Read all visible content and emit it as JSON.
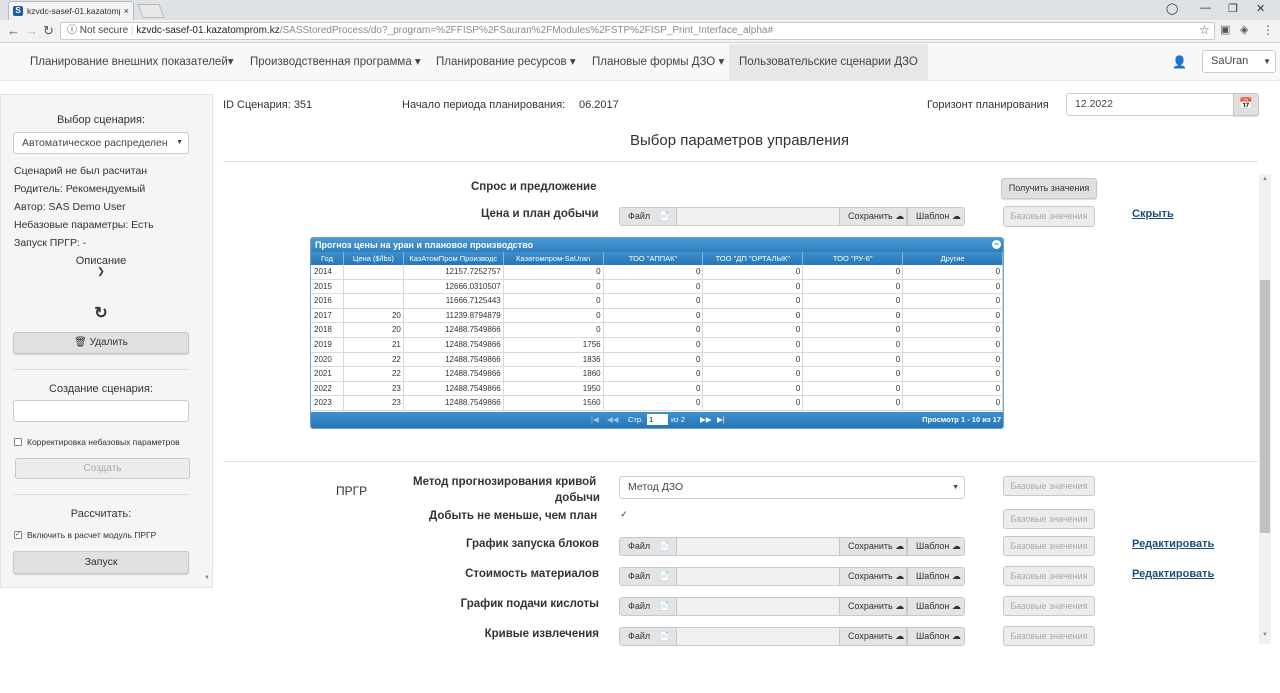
{
  "browser": {
    "tab_title": "kzvdc-sasef-01.kazatomp",
    "tab_close": "×",
    "security_label": "Not secure",
    "url_host": "kzvdc-sasef-01.kazatomprom.kz",
    "url_path": "/SASStoredProcess/do?_program=%2FFISP%2FSauran%2FModules%2FSTP%2FISP_Print_Interface_alpha#"
  },
  "nav": {
    "items": [
      {
        "label": "Планирование внешних показателей▾"
      },
      {
        "label": "Производственная программа ▾"
      },
      {
        "label": "Планирование ресурсов ▾"
      },
      {
        "label": "Плановые формы ДЗО ▾"
      },
      {
        "label": "Пользовательские сценарии ДЗО"
      }
    ],
    "user": "SaUran"
  },
  "left": {
    "scenario_select_label": "Выбор сценария:",
    "scenario_select_value": "Автоматическое распределен",
    "status": "Сценарий не был расчитан",
    "parent": "Родитель: Рекомендуемый",
    "author": "Автор: SAS Demo User",
    "nonbase": "Небазовые параметры: Есть",
    "prgr_run": "Запуск ПРГР: -",
    "description": "Описание",
    "delete_button": "Удалить",
    "create_label": "Создание сценария:",
    "create_input": "",
    "adjust_checkbox_label": "Корректировка небазовых параметров",
    "create_button": "Создать",
    "calc_label": "Рассчитать:",
    "include_checkbox_label": "Включить в расчет модуль ПРГР",
    "run_button": "Запуск"
  },
  "main": {
    "scenario_id": "ID Сценария: 351",
    "period_start_label": "Начало периода планирования:",
    "period_start_value": "06.2017",
    "horizon_label": "Горизонт планирования",
    "horizon_value": "12.2022",
    "title": "Выбор параметров управления",
    "demand_label": "Спрос и предложение",
    "get_values_button": "Получить значения",
    "price_label": "Цена и план добычи",
    "file_button": "Файл",
    "save_button": "Сохранить",
    "template_button": "Шаблон",
    "base_values_button": "Базовые значения",
    "hide_link": "Скрыть",
    "prgr_label": "ПРГР",
    "method_label_1": "Метод прогнозирования кривой",
    "method_label_2": "добычи",
    "method_value": "Метод ДЗО",
    "mine_not_less_label": "Добыть не меньше, чем план",
    "blocks_label": "График запуска блоков",
    "materials_label": "Стоимость материалов",
    "acid_label": "График подачи кислоты",
    "curves_label": "Кривые извлечения",
    "edit_link": "Редактировать"
  },
  "grid": {
    "caption": "Прогноз цены на уран и плановое производство",
    "columns": [
      "Год",
      "Цена ($/lbs)",
      "КазАтомПром Производс",
      "Казатомпром-SaUran",
      "ТОО \"АППАК\"",
      "ТОО \"ДП \"ОРТАЛЫК\"",
      "ТОО \"РУ-6\"",
      "Другие"
    ],
    "rows": [
      [
        "2014",
        "",
        "12157.7252757",
        "0",
        "0",
        "0",
        "0",
        "0"
      ],
      [
        "2015",
        "",
        "12666.0310507",
        "0",
        "0",
        "0",
        "0",
        "0"
      ],
      [
        "2016",
        "",
        "11666.7125443",
        "0",
        "0",
        "0",
        "0",
        "0"
      ],
      [
        "2017",
        "20",
        "11239.8794879",
        "0",
        "0",
        "0",
        "0",
        "0"
      ],
      [
        "2018",
        "20",
        "12488.7549866",
        "0",
        "0",
        "0",
        "0",
        "0"
      ],
      [
        "2019",
        "21",
        "12488.7549866",
        "1756",
        "0",
        "0",
        "0",
        "0"
      ],
      [
        "2020",
        "22",
        "12488.7549866",
        "1836",
        "0",
        "0",
        "0",
        "0"
      ],
      [
        "2021",
        "22",
        "12488.7549866",
        "1860",
        "0",
        "0",
        "0",
        "0"
      ],
      [
        "2022",
        "23",
        "12488.7549866",
        "1950",
        "0",
        "0",
        "0",
        "0"
      ],
      [
        "2023",
        "23",
        "12488.7549866",
        "1560",
        "0",
        "0",
        "0",
        "0"
      ]
    ],
    "pager_page_label": "Стр.",
    "pager_page_value": "1",
    "pager_of": "из 2",
    "pager_info": "Просмотр 1 - 10 из 17"
  }
}
